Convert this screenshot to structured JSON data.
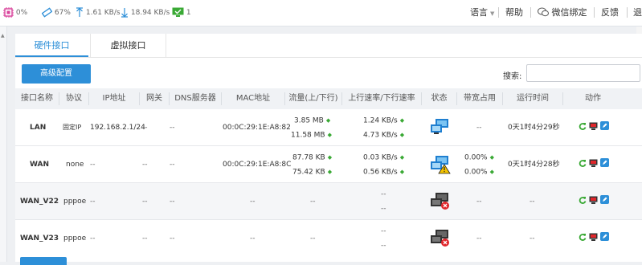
{
  "topbar": {
    "cpu": "0%",
    "mem": "67%",
    "upload": "1.61 KB/s",
    "download": "18.94 KB/s",
    "online": "1",
    "lang": "语言",
    "help": "帮助",
    "wechat": "微信绑定",
    "feedback": "反馈",
    "logout": "退"
  },
  "tabs": {
    "hardware": "硬件接口",
    "virtual": "虚拟接口"
  },
  "toolbar": {
    "advanced": "高级配置",
    "search_label": "搜索:",
    "search_value": ""
  },
  "table": {
    "headers": [
      "接口名称",
      "协议",
      "IP地址",
      "网关",
      "DNS服务器",
      "MAC地址",
      "流量(上/下行)",
      "上行速率/下行速率",
      "状态",
      "带宽占用",
      "运行时间",
      "动作"
    ],
    "rows": [
      {
        "name": "LAN",
        "proto": "固定IP",
        "ip": "192.168.2.1/24",
        "gw": "--",
        "dns": "--",
        "mac": "00:0C:29:1E:A8:82",
        "up": "3.85 MB",
        "down": "11.58 MB",
        "rate_up": "1.24 KB/s",
        "rate_down": "4.73 KB/s",
        "status": "connected",
        "bw1": "--",
        "bw2": "",
        "uptime": "0天1时4分29秒"
      },
      {
        "name": "WAN",
        "proto": "none",
        "ip": "--",
        "gw": "--",
        "dns": "--",
        "mac": "00:0C:29:1E:A8:8C",
        "up": "87.78 KB",
        "down": "75.42 KB",
        "rate_up": "0.03 KB/s",
        "rate_down": "0.56 KB/s",
        "status": "warning",
        "bw1": "0.00%",
        "bw2": "0.00%",
        "uptime": "0天1时4分28秒"
      },
      {
        "name": "WAN_V22",
        "proto": "pppoe",
        "ip": "--",
        "gw": "--",
        "dns": "--",
        "mac": "--",
        "up": "--",
        "down": "",
        "rate_up": "--",
        "rate_down": "--",
        "status": "disconnected",
        "bw1": "--",
        "bw2": "",
        "uptime": "--"
      },
      {
        "name": "WAN_V23",
        "proto": "pppoe",
        "ip": "--",
        "gw": "--",
        "dns": "--",
        "mac": "--",
        "up": "--",
        "down": "",
        "rate_up": "--",
        "rate_down": "--",
        "status": "disconnected",
        "bw1": "--",
        "bw2": "",
        "uptime": "--"
      }
    ]
  },
  "colors": {
    "accent": "#2d8fd8",
    "ok": "#3aa935",
    "error": "#e0262b"
  }
}
